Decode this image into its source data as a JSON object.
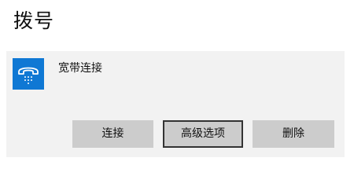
{
  "header": {
    "title": "拨号"
  },
  "connection": {
    "icon": "dialup-phone-icon",
    "name": "宽带连接",
    "buttons": {
      "connect": "连接",
      "advanced": "高级选项",
      "delete": "删除"
    }
  },
  "colors": {
    "icon_background": "#0f78d4",
    "panel_background": "#f2f2f2",
    "button_background": "#cccccc",
    "focused_border": "#333333"
  }
}
